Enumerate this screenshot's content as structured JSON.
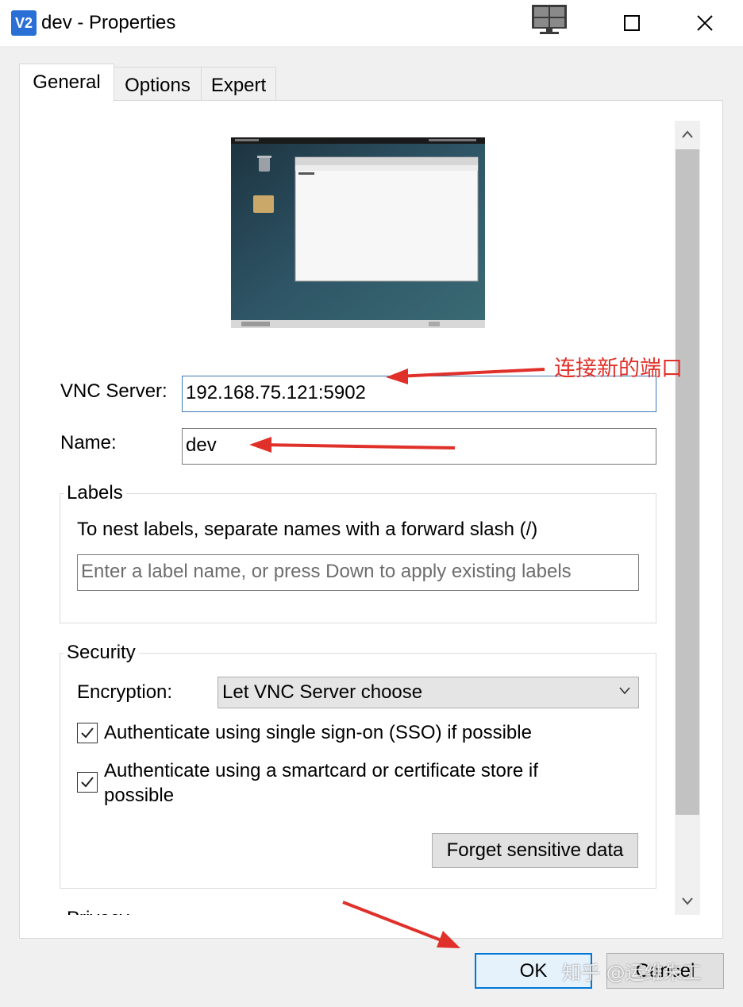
{
  "window": {
    "title": "dev - Properties",
    "app_icon": "VNC Viewer logo",
    "app_icon_text": "V2",
    "controls": [
      "monitor-icon",
      "maximize-icon",
      "close-icon"
    ]
  },
  "tabs": [
    {
      "label": "General",
      "selected": true
    },
    {
      "label": "Options",
      "selected": false
    },
    {
      "label": "Expert",
      "selected": false
    }
  ],
  "general": {
    "vnc_server_label": "VNC Server:",
    "vnc_server_value": "192.168.75.121:5902",
    "name_label": "Name:",
    "name_value": "dev",
    "labels": {
      "title": "Labels",
      "hint": "To nest labels, separate names with a forward slash (/)",
      "input_placeholder": "Enter a label name, or press Down to apply existing labels"
    },
    "security": {
      "title": "Security",
      "encryption_label": "Encryption:",
      "encryption_value": "Let VNC Server choose",
      "sso_label": "Authenticate using single sign-on (SSO) if possible",
      "sso_checked": true,
      "smartcard_label": "Authenticate using a smartcard or certificate store if possible",
      "smartcard_checked": true,
      "forget_button": "Forget sensitive data"
    },
    "privacy_title_partial": "Privacy"
  },
  "buttons": {
    "ok": "OK",
    "cancel": "Cancel"
  },
  "annotation": {
    "text": "连接新的端口",
    "color": "#e0302a"
  },
  "watermark": "知乎 @运维朱工",
  "colors": {
    "accent": "#0078d7",
    "focus_border": "#3e78b7",
    "annotation": "#e0302a"
  }
}
